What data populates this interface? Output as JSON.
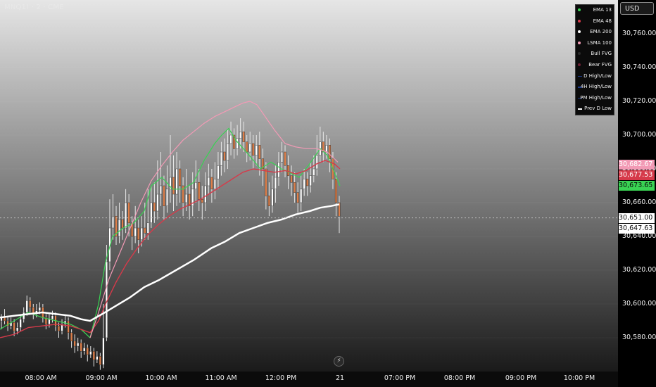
{
  "header": {
    "symbol": "MNQ1! · 2 · CME",
    "currency_button": "USD"
  },
  "legend": [
    {
      "label": "EMA 13",
      "color": "#39d353",
      "icon": "dot"
    },
    {
      "label": "EMA 48",
      "color": "#d63a4a",
      "icon": "dot"
    },
    {
      "label": "EMA 200",
      "color": "#ffffff",
      "icon": "dot"
    },
    {
      "label": "LSMA 100",
      "color": "#f29ab5",
      "icon": "dot"
    },
    {
      "label": "Bull FVG",
      "color": "#2a2a2a",
      "icon": "dot"
    },
    {
      "label": "Bear FVG",
      "color": "#6b1f33",
      "icon": "dot"
    },
    {
      "label": "D High/Low",
      "color": "#1e3a8a",
      "icon": "line"
    },
    {
      "label": "4H High/Low",
      "color": "#1e3a8a",
      "icon": "line"
    },
    {
      "label": "PM High/Low",
      "color": "#1e3a8a",
      "icon": "line"
    },
    {
      "label": "Prev D Low",
      "color": "#ffffff",
      "icon": "line"
    }
  ],
  "price_tags": [
    {
      "label": "30,682.67",
      "value": 30682.67,
      "bg": "#f29ab5",
      "fg": "#ffffff"
    },
    {
      "label": "30,677.53",
      "value": 30677.53,
      "bg": "#d63a4a",
      "fg": "#ffffff"
    },
    {
      "label": "30,673.65",
      "value": 30673.65,
      "bg": "#39d353",
      "fg": "#0b0b0b"
    },
    {
      "label": "30,651.00",
      "value": 30651.0,
      "bg": "#ffffff",
      "fg": "#0b0b0b"
    },
    {
      "label": "30,647.63",
      "value": 30647.63,
      "bg": "#ffffff",
      "fg": "#0b0b0b"
    }
  ],
  "bolt_icon": "lightning-icon",
  "chart_data": {
    "type": "candlestick",
    "title": "MNQ1! · 2 · CME",
    "y_ticks": [
      "30,580.00",
      "30,600.00",
      "30,620.00",
      "30,640.00",
      "30,660.00",
      "30,680.00",
      "30,700.00",
      "30,720.00",
      "30,740.00",
      "30,760.00"
    ],
    "y_tick_values": [
      30580,
      30600,
      30620,
      30640,
      30660,
      30680,
      30700,
      30720,
      30740,
      30760
    ],
    "ylim": [
      30560,
      30780
    ],
    "x_ticks": [
      "08:00 AM",
      "09:00 AM",
      "10:00 AM",
      "11:00 AM",
      "12:00 PM",
      "21",
      "07:00 PM",
      "08:00 PM",
      "09:00 PM",
      "10:00 PM"
    ],
    "last_price": 30651.0,
    "colors": {
      "up": "#ffffff",
      "down": "#e0804a"
    },
    "background": {
      "top": "#e6e6e6",
      "bottom": "#1a1a1a"
    },
    "series": [
      {
        "name": "EMA 13",
        "color": "#39d353",
        "width": 1.2,
        "points": [
          [
            0,
            30585
          ],
          [
            20,
            30590
          ],
          [
            40,
            30595
          ],
          [
            60,
            30592
          ],
          [
            80,
            30590
          ],
          [
            100,
            30588
          ],
          [
            115,
            30585
          ],
          [
            128,
            30580
          ],
          [
            140,
            30600
          ],
          [
            150,
            30625
          ],
          [
            160,
            30640
          ],
          [
            175,
            30645
          ],
          [
            190,
            30648
          ],
          [
            205,
            30655
          ],
          [
            215,
            30670
          ],
          [
            230,
            30675
          ],
          [
            245,
            30668
          ],
          [
            260,
            30668
          ],
          [
            275,
            30672
          ],
          [
            290,
            30685
          ],
          [
            305,
            30695
          ],
          [
            315,
            30700
          ],
          [
            325,
            30704
          ],
          [
            335,
            30697
          ],
          [
            350,
            30690
          ],
          [
            360,
            30685
          ],
          [
            370,
            30680
          ],
          [
            385,
            30684
          ],
          [
            400,
            30680
          ],
          [
            410,
            30678
          ],
          [
            425,
            30675
          ],
          [
            440,
            30683
          ],
          [
            455,
            30692
          ],
          [
            465,
            30688
          ],
          [
            475,
            30678
          ],
          [
            483,
            30670
          ]
        ]
      },
      {
        "name": "EMA 48",
        "color": "#d63a4a",
        "width": 1.4,
        "points": [
          [
            0,
            30580
          ],
          [
            20,
            30582
          ],
          [
            40,
            30586
          ],
          [
            60,
            30587
          ],
          [
            80,
            30588
          ],
          [
            100,
            30587
          ],
          [
            115,
            30585
          ],
          [
            128,
            30583
          ],
          [
            140,
            30590
          ],
          [
            150,
            30600
          ],
          [
            165,
            30613
          ],
          [
            180,
            30624
          ],
          [
            195,
            30633
          ],
          [
            210,
            30641
          ],
          [
            225,
            30647
          ],
          [
            240,
            30652
          ],
          [
            255,
            30656
          ],
          [
            270,
            30659
          ],
          [
            285,
            30662
          ],
          [
            300,
            30666
          ],
          [
            315,
            30670
          ],
          [
            330,
            30674
          ],
          [
            345,
            30678
          ],
          [
            360,
            30680
          ],
          [
            375,
            30679
          ],
          [
            390,
            30678
          ],
          [
            405,
            30679
          ],
          [
            420,
            30677
          ],
          [
            435,
            30679
          ],
          [
            450,
            30683
          ],
          [
            462,
            30685
          ],
          [
            475,
            30683
          ],
          [
            483,
            30680
          ]
        ]
      },
      {
        "name": "LSMA 100",
        "color": "#f29ab5",
        "width": 1.2,
        "points": [
          [
            128,
            30580
          ],
          [
            140,
            30595
          ],
          [
            155,
            30615
          ],
          [
            170,
            30630
          ],
          [
            185,
            30645
          ],
          [
            200,
            30660
          ],
          [
            215,
            30673
          ],
          [
            230,
            30682
          ],
          [
            245,
            30690
          ],
          [
            260,
            30697
          ],
          [
            275,
            30702
          ],
          [
            290,
            30707
          ],
          [
            305,
            30711
          ],
          [
            320,
            30714
          ],
          [
            335,
            30717
          ],
          [
            345,
            30719
          ],
          [
            355,
            30720
          ],
          [
            365,
            30718
          ],
          [
            375,
            30712
          ],
          [
            390,
            30703
          ],
          [
            405,
            30695
          ],
          [
            420,
            30693
          ],
          [
            435,
            30692
          ],
          [
            450,
            30692
          ],
          [
            465,
            30690
          ],
          [
            480,
            30684
          ]
        ]
      },
      {
        "name": "EMA 200",
        "color": "#ffffff",
        "width": 2.5,
        "points": [
          [
            0,
            30592
          ],
          [
            20,
            30593
          ],
          [
            40,
            30594
          ],
          [
            60,
            30595
          ],
          [
            80,
            30594
          ],
          [
            100,
            30593
          ],
          [
            115,
            30591
          ],
          [
            128,
            30590
          ],
          [
            145,
            30594
          ],
          [
            165,
            30599
          ],
          [
            185,
            30604
          ],
          [
            205,
            30610
          ],
          [
            225,
            30614
          ],
          [
            250,
            30620
          ],
          [
            275,
            30626
          ],
          [
            300,
            30633
          ],
          [
            320,
            30637
          ],
          [
            340,
            30642
          ],
          [
            360,
            30645
          ],
          [
            380,
            30648
          ],
          [
            400,
            30650
          ],
          [
            420,
            30653
          ],
          [
            440,
            30655
          ],
          [
            455,
            30657
          ],
          [
            470,
            30658
          ],
          [
            482,
            30659
          ]
        ]
      }
    ],
    "candles": [
      [
        30590,
        30592,
        30585,
        30594
      ],
      [
        30592,
        30590,
        30588,
        30597
      ],
      [
        30590,
        30587,
        30584,
        30593
      ],
      [
        30587,
        30589,
        30585,
        30592
      ],
      [
        30589,
        30584,
        30581,
        30591
      ],
      [
        30584,
        30586,
        30582,
        30589
      ],
      [
        30586,
        30591,
        30584,
        30593
      ],
      [
        30591,
        30595,
        30589,
        30598
      ],
      [
        30595,
        30602,
        30593,
        30605
      ],
      [
        30602,
        30598,
        30595,
        30604
      ],
      [
        30598,
        30594,
        30591,
        30600
      ],
      [
        30594,
        30596,
        30592,
        30600
      ],
      [
        30596,
        30598,
        30594,
        30601
      ],
      [
        30598,
        30592,
        30589,
        30600
      ],
      [
        30592,
        30588,
        30585,
        30594
      ],
      [
        30588,
        30591,
        30586,
        30594
      ],
      [
        30591,
        30593,
        30589,
        30596
      ],
      [
        30593,
        30587,
        30584,
        30595
      ],
      [
        30587,
        30584,
        30580,
        30589
      ],
      [
        30584,
        30588,
        30582,
        30591
      ],
      [
        30588,
        30590,
        30586,
        30593
      ],
      [
        30590,
        30583,
        30579,
        30592
      ],
      [
        30583,
        30578,
        30574,
        30585
      ],
      [
        30578,
        30575,
        30571,
        30582
      ],
      [
        30575,
        30577,
        30572,
        30580
      ],
      [
        30577,
        30572,
        30568,
        30579
      ],
      [
        30572,
        30574,
        30570,
        30577
      ],
      [
        30574,
        30570,
        30566,
        30576
      ],
      [
        30570,
        30572,
        30568,
        30575
      ],
      [
        30572,
        30567,
        30563,
        30574
      ],
      [
        30567,
        30569,
        30565,
        30572
      ],
      [
        30569,
        30564,
        30561,
        30571
      ],
      [
        30564,
        30580,
        30562,
        30600
      ],
      [
        30580,
        30625,
        30578,
        30635
      ],
      [
        30625,
        30645,
        30620,
        30662
      ],
      [
        30645,
        30652,
        30638,
        30665
      ],
      [
        30652,
        30640,
        30635,
        30658
      ],
      [
        30640,
        30650,
        30636,
        30660
      ],
      [
        30650,
        30645,
        30638,
        30655
      ],
      [
        30645,
        30660,
        30642,
        30668
      ],
      [
        30660,
        30648,
        30640,
        30665
      ],
      [
        30648,
        30640,
        30632,
        30652
      ],
      [
        30640,
        30645,
        30636,
        30658
      ],
      [
        30645,
        30638,
        30630,
        30650
      ],
      [
        30638,
        30645,
        30634,
        30652
      ],
      [
        30645,
        30642,
        30638,
        30660
      ],
      [
        30642,
        30648,
        30638,
        30668
      ],
      [
        30648,
        30660,
        30645,
        30670
      ],
      [
        30660,
        30655,
        30648,
        30672
      ],
      [
        30655,
        30665,
        30650,
        30685
      ],
      [
        30665,
        30670,
        30658,
        30690
      ],
      [
        30670,
        30658,
        30650,
        30676
      ],
      [
        30658,
        30668,
        30654,
        30682
      ],
      [
        30668,
        30675,
        30660,
        30700
      ],
      [
        30675,
        30665,
        30655,
        30688
      ],
      [
        30665,
        30680,
        30658,
        30690
      ],
      [
        30680,
        30670,
        30660,
        30685
      ],
      [
        30670,
        30660,
        30652,
        30675
      ],
      [
        30660,
        30665,
        30655,
        30680
      ],
      [
        30665,
        30658,
        30650,
        30670
      ],
      [
        30658,
        30668,
        30652,
        30678
      ],
      [
        30668,
        30672,
        30660,
        30685
      ],
      [
        30672,
        30662,
        30655,
        30680
      ],
      [
        30662,
        30660,
        30650,
        30670
      ],
      [
        30660,
        30670,
        30655,
        30678
      ],
      [
        30670,
        30675,
        30665,
        30683
      ],
      [
        30675,
        30668,
        30660,
        30680
      ],
      [
        30668,
        30674,
        30662,
        30684
      ],
      [
        30674,
        30682,
        30668,
        30690
      ],
      [
        30682,
        30690,
        30676,
        30696
      ],
      [
        30690,
        30685,
        30678,
        30698
      ],
      [
        30685,
        30695,
        30680,
        30703
      ],
      [
        30695,
        30700,
        30688,
        30708
      ],
      [
        30700,
        30692,
        30686,
        30704
      ],
      [
        30692,
        30698,
        30688,
        30706
      ],
      [
        30698,
        30702,
        30692,
        30710
      ],
      [
        30702,
        30696,
        30690,
        30708
      ],
      [
        30696,
        30690,
        30684,
        30700
      ],
      [
        30690,
        30695,
        30685,
        30702
      ],
      [
        30695,
        30688,
        30680,
        30700
      ],
      [
        30688,
        30694,
        30682,
        30700
      ],
      [
        30694,
        30686,
        30676,
        30702
      ],
      [
        30686,
        30680,
        30670,
        30692
      ],
      [
        30680,
        30664,
        30656,
        30684
      ],
      [
        30664,
        30658,
        30652,
        30672
      ],
      [
        30658,
        30668,
        30654,
        30676
      ],
      [
        30668,
        30675,
        30660,
        30682
      ],
      [
        30675,
        30684,
        30670,
        30690
      ],
      [
        30684,
        30690,
        30678,
        30696
      ],
      [
        30690,
        30682,
        30675,
        30694
      ],
      [
        30682,
        30676,
        30668,
        30688
      ],
      [
        30676,
        30672,
        30664,
        30682
      ],
      [
        30672,
        30666,
        30660,
        30678
      ],
      [
        30666,
        30660,
        30654,
        30672
      ],
      [
        30660,
        30668,
        30655,
        30676
      ],
      [
        30668,
        30674,
        30664,
        30680
      ],
      [
        30674,
        30670,
        30664,
        30678
      ],
      [
        30670,
        30676,
        30666,
        30684
      ],
      [
        30676,
        30680,
        30672,
        30688
      ],
      [
        30680,
        30688,
        30676,
        30700
      ],
      [
        30688,
        30696,
        30684,
        30705
      ],
      [
        30696,
        30690,
        30684,
        30702
      ],
      [
        30690,
        30694,
        30686,
        30700
      ],
      [
        30694,
        30686,
        30678,
        30698
      ],
      [
        30686,
        30674,
        30668,
        30690
      ],
      [
        30674,
        30660,
        30652,
        30678
      ],
      [
        30660,
        30652,
        30642,
        30664
      ]
    ]
  }
}
